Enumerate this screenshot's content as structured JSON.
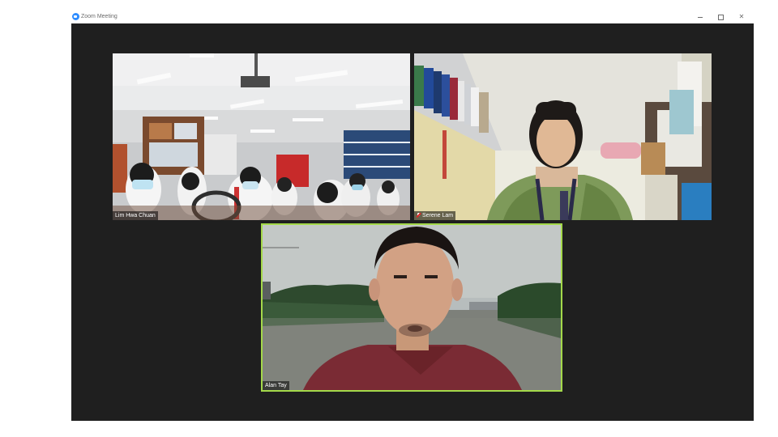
{
  "window": {
    "title": "Zoom Meeting",
    "icon": "zoom-logo-icon",
    "controls": [
      "minimize-icon",
      "restore-icon",
      "close-icon"
    ]
  },
  "participants": [
    {
      "name": "Lim Hwa Chuan",
      "muted": false,
      "active_speaker": false
    },
    {
      "name": "Serene Lam",
      "muted": true,
      "active_speaker": false
    },
    {
      "name": "Alan Tay",
      "muted": false,
      "active_speaker": true
    }
  ],
  "colors": {
    "meeting_background": "#1f1f1f",
    "active_speaker_border": "#a4d94a",
    "zoom_brand": "#2d8cff",
    "mute_indicator": "#e02828"
  }
}
